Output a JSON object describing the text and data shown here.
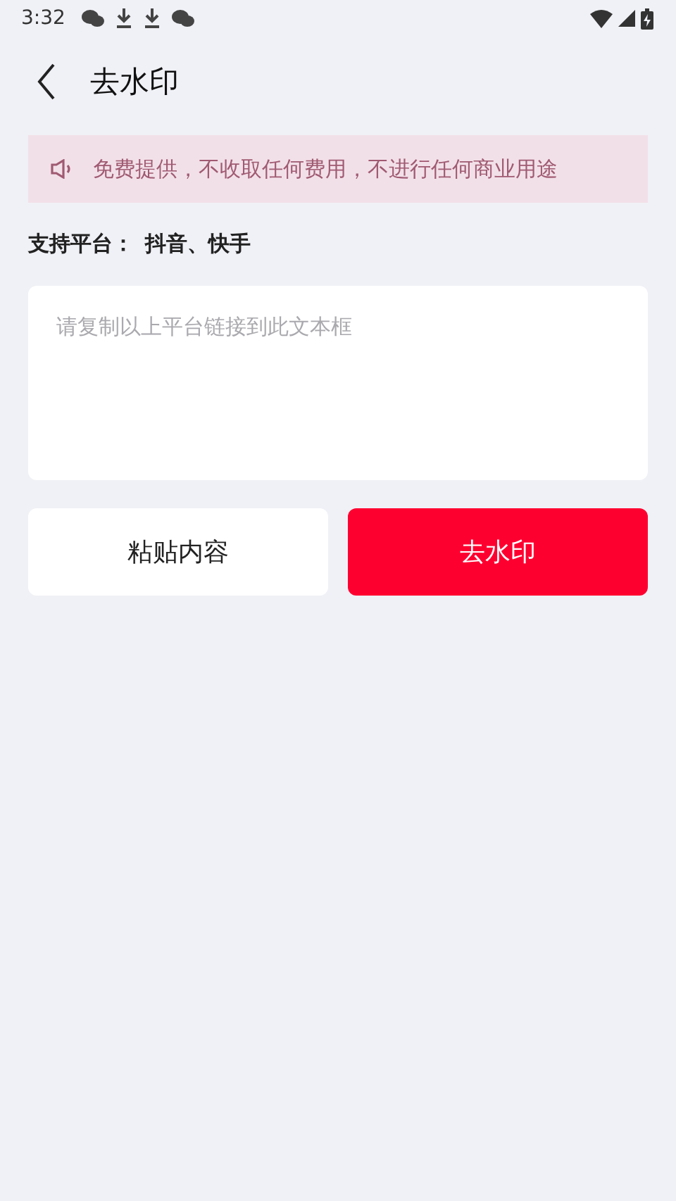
{
  "status_bar": {
    "time": "3:32",
    "notification_icons": [
      {
        "kind": "chat"
      },
      {
        "kind": "download"
      },
      {
        "kind": "download"
      },
      {
        "kind": "chat"
      }
    ]
  },
  "header": {
    "title": "去水印"
  },
  "notice": {
    "text": "免费提供，不收取任何费用，不进行任何商业用途"
  },
  "platforms": {
    "label": "支持平台：",
    "value": "抖音、快手"
  },
  "link_field": {
    "placeholder": "请复制以上平台链接到此文本框"
  },
  "buttons": [
    {
      "label": "粘贴内容",
      "kind": "secondary"
    },
    {
      "label": "去水印",
      "kind": "primary"
    }
  ]
}
